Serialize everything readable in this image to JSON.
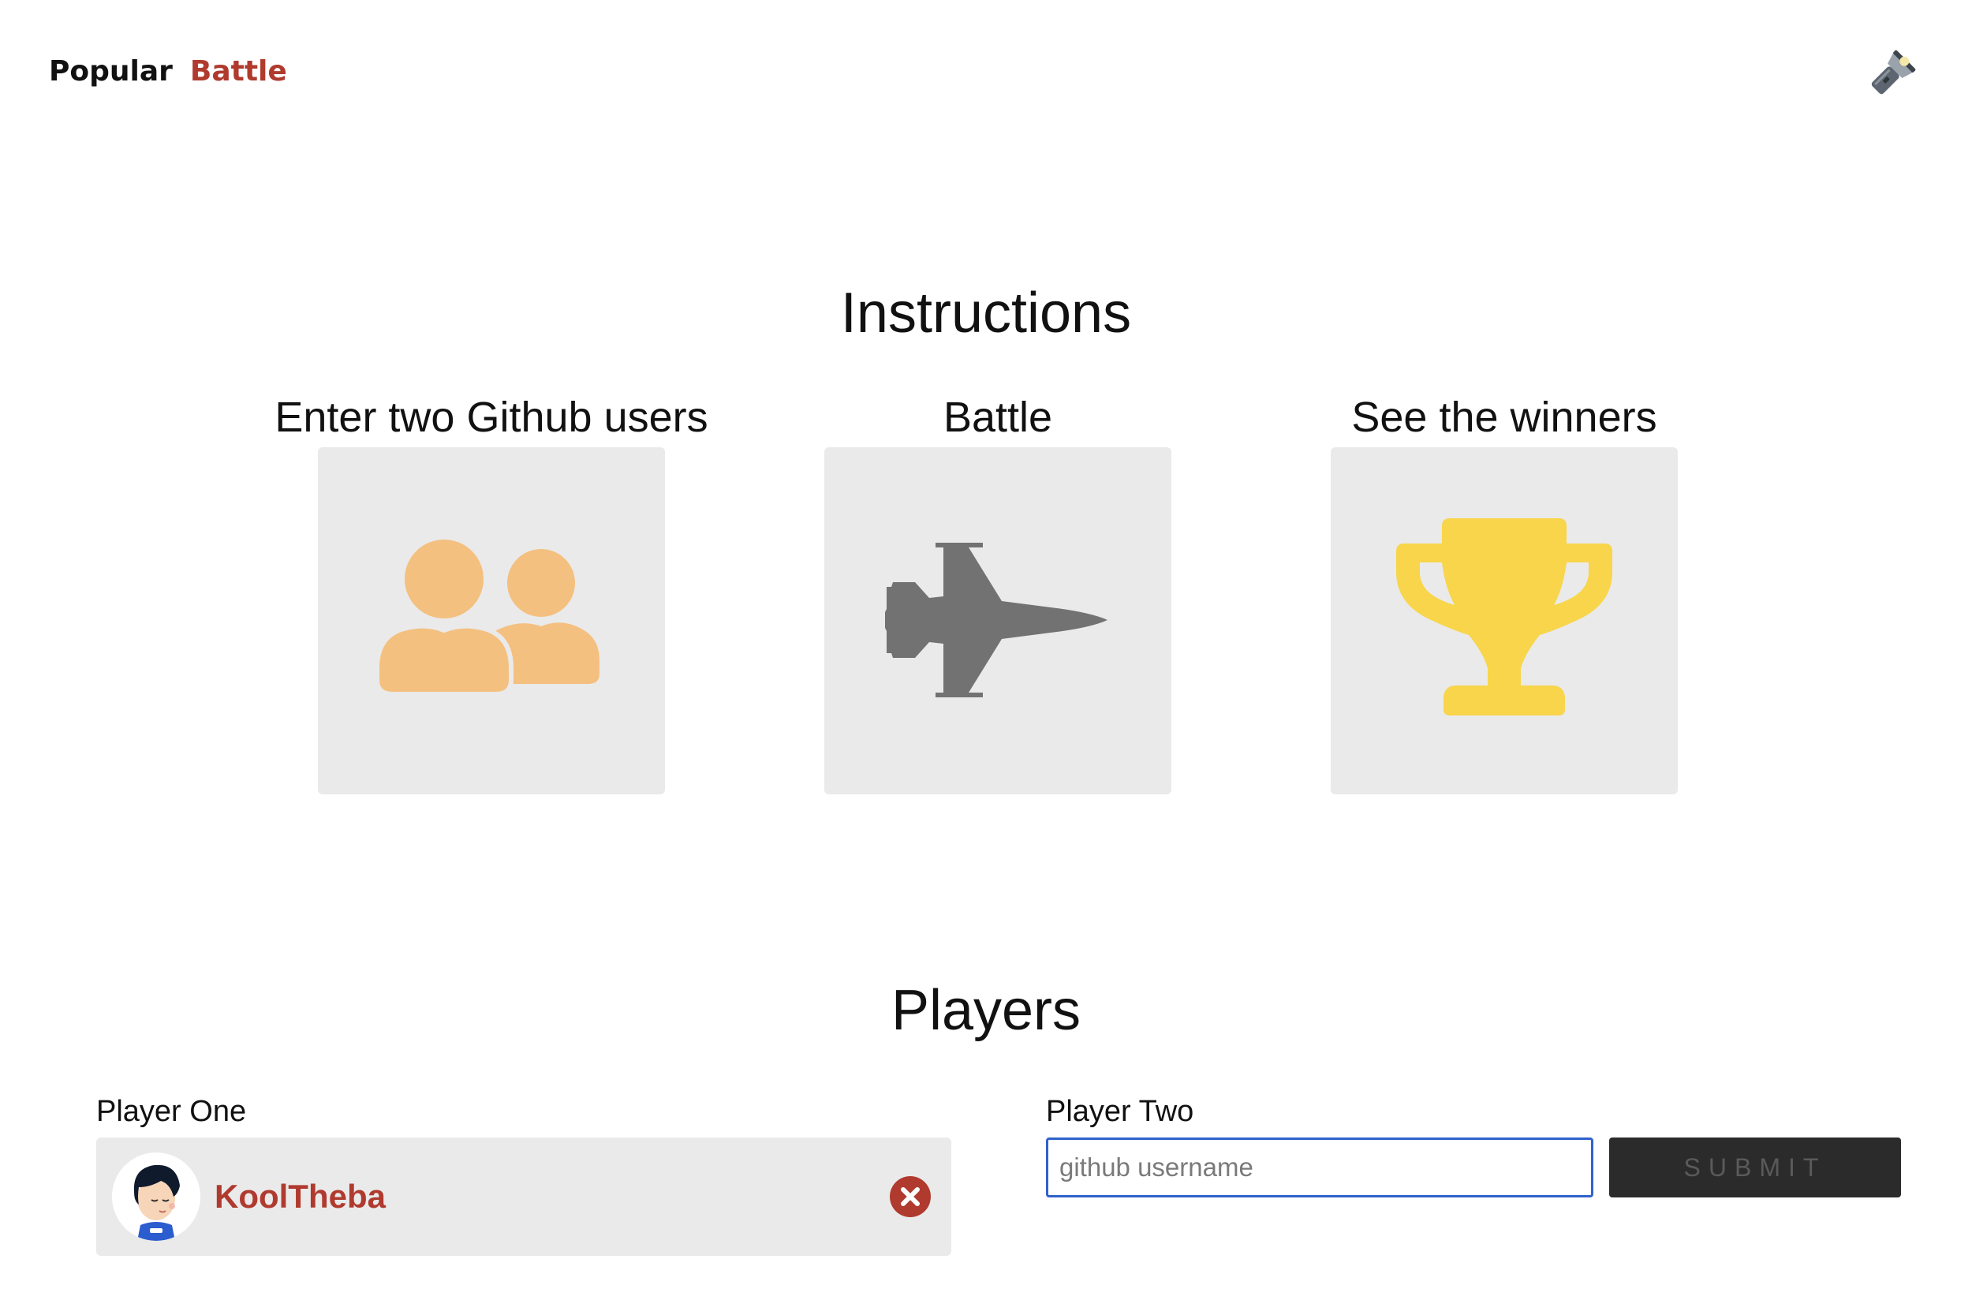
{
  "nav": {
    "items": [
      {
        "label": "Popular",
        "active": false
      },
      {
        "label": "Battle",
        "active": true
      }
    ]
  },
  "theme_toggle": {
    "icon": "flashlight-icon"
  },
  "instructions": {
    "title": "Instructions",
    "steps": [
      {
        "title": "Enter two Github users",
        "icon": "users-icon",
        "icon_color": "#f4c07f"
      },
      {
        "title": "Battle",
        "icon": "fighter-jet-icon",
        "icon_color": "#727272"
      },
      {
        "title": "See the winners",
        "icon": "trophy-icon",
        "icon_color": "#f8d54a"
      }
    ]
  },
  "players": {
    "title": "Players",
    "player_one": {
      "label": "Player One",
      "username": "KoolTheba",
      "remove_icon": "close-circle-icon"
    },
    "player_two": {
      "label": "Player Two",
      "input_value": "",
      "placeholder": "github username",
      "submit_label": "SUBMIT"
    }
  },
  "colors": {
    "accent": "#b03a2e",
    "card_background": "#eaeaea",
    "input_focus_border": "#2f62cc",
    "button_background": "#2b2b2b"
  }
}
